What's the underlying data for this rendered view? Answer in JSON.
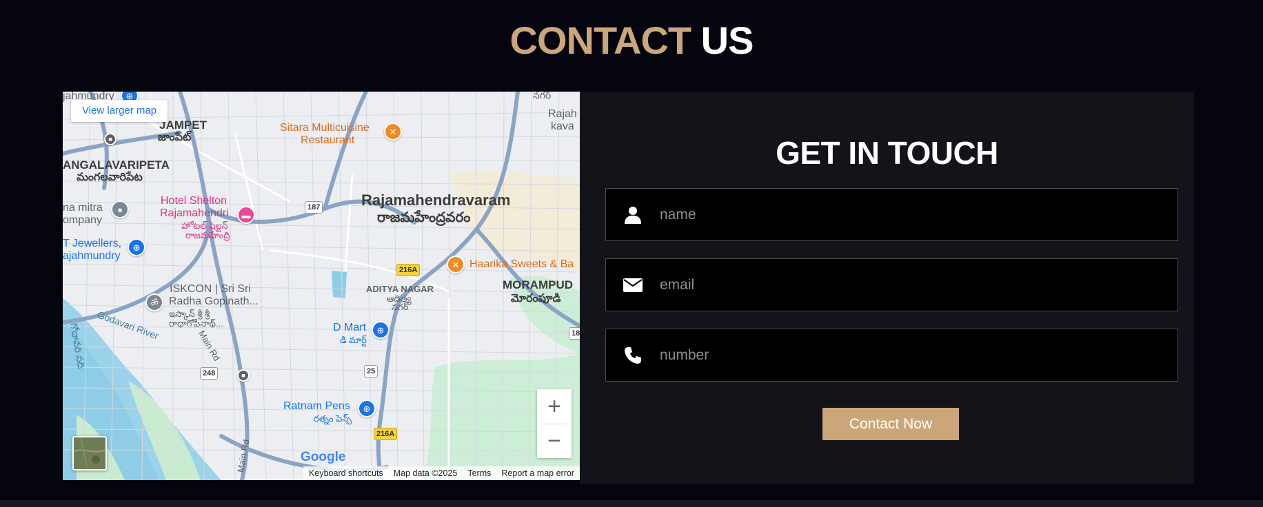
{
  "section_title": {
    "accent": "CONTACT",
    "plain": "US"
  },
  "map": {
    "larger_map_link": "View larger map",
    "labels": {
      "rajahmundry_top": "jahmundry",
      "jampet_en": "JAMPET",
      "jampet_te": "జాంపేట్",
      "sitara_1": "Sitara Multicuisine",
      "sitara_2": "Restaurant",
      "top_right_1": "Rajah",
      "top_right_2": "kava",
      "top_nagar": "నగర్",
      "mangalavaripeta_en": "ANGALAVARIPETA",
      "mangalavaripeta_te": "మంగలవారిపేట",
      "mitra_1": "na mitra",
      "mitra_2": "ompany",
      "hotel_1": "Hotel Shelton",
      "hotel_2": "Rajamahendri",
      "hotel_te1": "హోటల్ షెల్టన్",
      "hotel_te2": "రాజమహేంద్రి",
      "city_en": "Rajamahendravaram",
      "city_te": "రాజమహేంద్రవరం",
      "jewellers_1": "T Jewellers,",
      "jewellers_2": "ajahmundry",
      "haarika": "Haarika Sweets & Ba",
      "iskcon_1": "ISKCON | Sri Sri",
      "iskcon_2": "Radha Gopinath...",
      "iskcon_te1": "ఇస్కాన్ శ్రీ శ్రీ",
      "iskcon_te2": "రాధాగోపీనాథ్...",
      "aditya_en": "ADITYA NAGAR",
      "aditya_te1": "ఆదిత్య",
      "aditya_te2": "నగర్",
      "morampudi_en": "MORAMPUD",
      "morampudi_te": "మోరంపూడి",
      "godavari_river": "Godavari River",
      "godavari_te": "గోదావరి నది",
      "dmart_en": "D Mart",
      "dmart_te": "డి మార్ట్",
      "main_rd_1": "Main Rd",
      "main_rd_2": "Main Rd",
      "ratnam_en": "Ratnam Pens",
      "ratnam_te": "రత్నం పెన్స్"
    },
    "shields": {
      "s187": "187",
      "s216a_1": "216A",
      "s216a_2": "216A",
      "s248": "248",
      "s25": "25",
      "s18": "18"
    },
    "zoom_in": "+",
    "zoom_out": "−",
    "google_logo": "Google",
    "attribution": {
      "shortcuts": "Keyboard shortcuts",
      "data": "Map data ©2025",
      "terms": "Terms",
      "report": "Report a map error"
    }
  },
  "form": {
    "title": "GET IN TOUCH",
    "name_placeholder": "name",
    "email_placeholder": "email",
    "number_placeholder": "number",
    "submit_label": "Contact Now"
  },
  "colors": {
    "page_bg": "#05050f",
    "accent": "#cba67a",
    "panel_bg": "#131419",
    "field_bg": "#000000"
  }
}
